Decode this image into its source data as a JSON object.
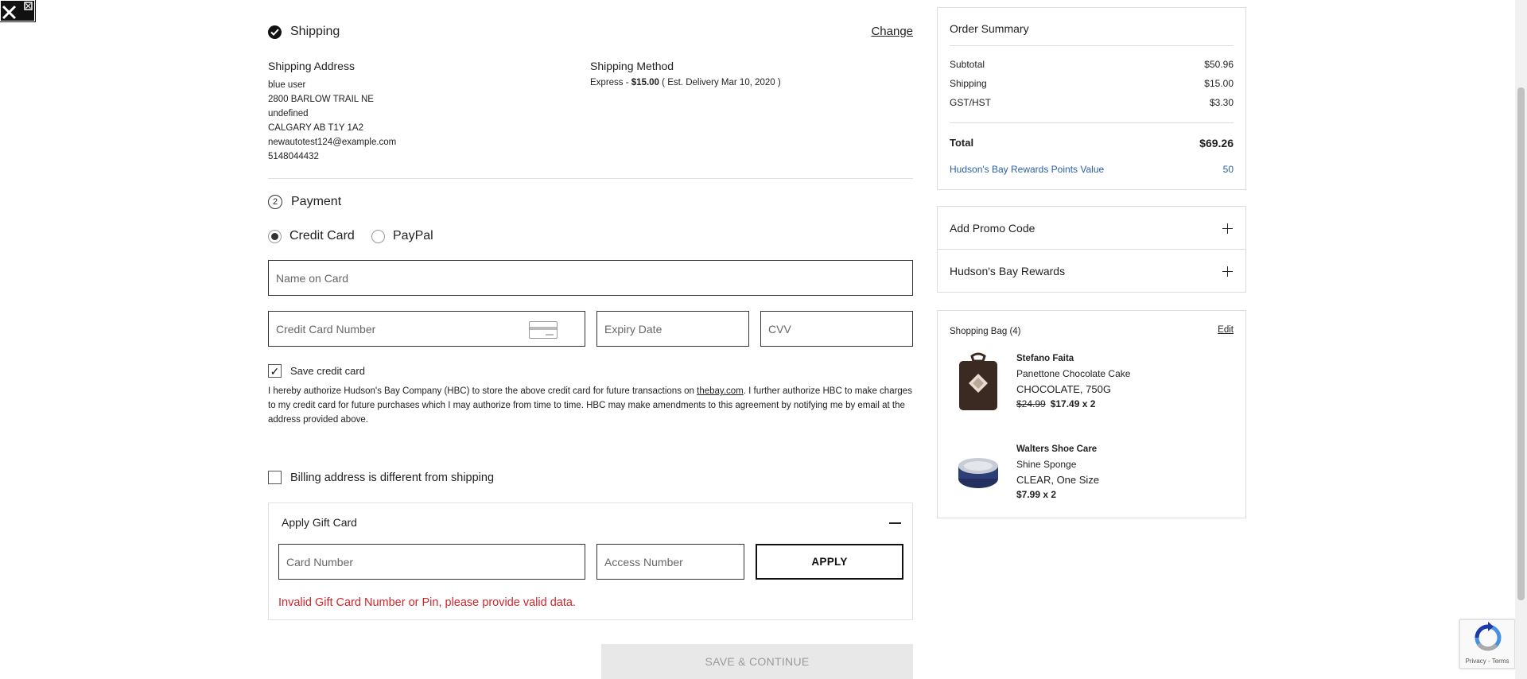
{
  "shipping": {
    "title": "Shipping",
    "change_label": "Change",
    "address_label": "Shipping Address",
    "address_lines": [
      "blue user",
      "2800 BARLOW TRAIL NE",
      "undefined",
      "CALGARY AB T1Y 1A2",
      "newautotest124@example.com",
      "5148044432"
    ],
    "method_label": "Shipping Method",
    "method_name": "Express -",
    "method_price": "$15.00",
    "method_delivery": "( Est. Delivery Mar 10, 2020 )"
  },
  "payment": {
    "step": "2",
    "title": "Payment",
    "options": [
      "Credit Card",
      "PayPal"
    ],
    "selected": "Credit Card",
    "name_placeholder": "Name on Card",
    "card_number_placeholder": "Credit Card Number",
    "expiry_placeholder": "Expiry Date",
    "cvv_placeholder": "CVV",
    "save_card_label": "Save credit card",
    "save_card_checked": true,
    "auth_text_1": "I hereby authorize Hudson's Bay Company (HBC) to store the above credit card for future transactions on ",
    "auth_link": "thebay.com",
    "auth_text_2": ". I further authorize HBC to make charges to my credit card for future purchases which I may authorize from time to time. HBC may make amendments to this agreement by notifying me by email at the address provided above.",
    "billing_label": "Billing address is different from shipping",
    "billing_checked": false
  },
  "gift_card": {
    "title": "Apply Gift Card",
    "card_number_placeholder": "Card Number",
    "access_number_placeholder": "Access Number",
    "apply_label": "APPLY",
    "error": "Invalid Gift Card Number or Pin, please provide valid data."
  },
  "save_continue_label": "SAVE & CONTINUE",
  "summary": {
    "title": "Order Summary",
    "subtotal_label": "Subtotal",
    "subtotal": "$50.96",
    "shipping_label": "Shipping",
    "shipping": "$15.00",
    "tax_label": "GST/HST",
    "tax": "$3.30",
    "total_label": "Total",
    "total": "$69.26",
    "rewards_label": "Hudson's Bay Rewards Points Value",
    "rewards": "50"
  },
  "promo_label": "Add Promo Code",
  "rewards_label": "Hudson's Bay Rewards",
  "bag": {
    "title": "Shopping Bag (4)",
    "edit_label": "Edit",
    "items": [
      {
        "brand": "Stefano Faita",
        "name": "Panettone Chocolate Cake",
        "variant": "CHOCOLATE, 750G",
        "original_price": "$24.99",
        "price": "$17.49 x 2"
      },
      {
        "brand": "Walters Shoe Care",
        "name": "Shine Sponge",
        "variant": "CLEAR, One Size",
        "original_price": "",
        "price": "$7.99 x 2"
      }
    ]
  },
  "recaptcha_text": "Privacy - Terms",
  "colors": {
    "error": "#d0262d",
    "link": "#2a5fa8",
    "disabled_bg": "#e8e8e8"
  }
}
